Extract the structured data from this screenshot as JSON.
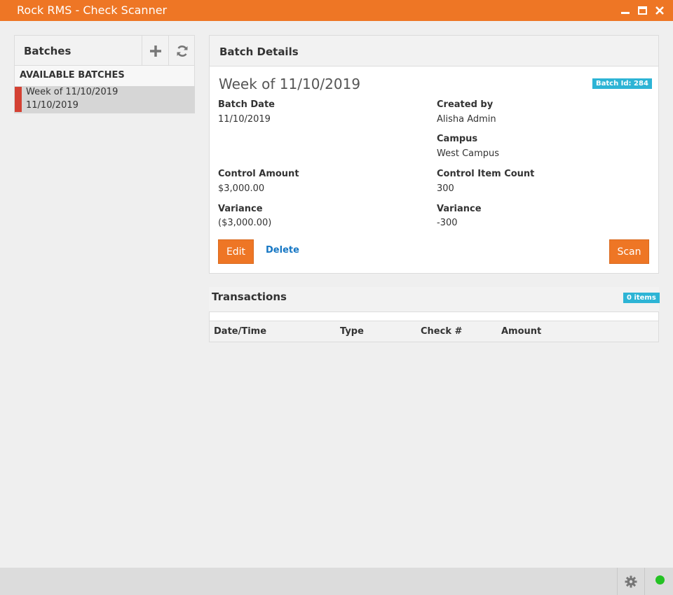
{
  "window": {
    "title": "Rock RMS - Check Scanner",
    "accent_color": "#ee7625"
  },
  "batches": {
    "header": "Batches",
    "add_icon": "plus-icon",
    "refresh_icon": "refresh-icon",
    "section_label": "AVAILABLE BATCHES",
    "items": [
      {
        "name": "Week of 11/10/2019",
        "date": "11/10/2019",
        "status_color": "#d44133"
      }
    ]
  },
  "details": {
    "header": "Batch Details",
    "title": "Week of 11/10/2019",
    "batch_id_badge": "Batch Id: 284",
    "batch_date_label": "Batch Date",
    "batch_date": "11/10/2019",
    "created_by_label": "Created by",
    "created_by": "Alisha Admin",
    "campus_label": "Campus",
    "campus": "West Campus",
    "control_amount_label": "Control Amount",
    "control_amount": "$3,000.00",
    "control_item_count_label": "Control Item Count",
    "control_item_count": "300",
    "variance_amount_label": "Variance",
    "variance_amount": "($3,000.00)",
    "variance_count_label": "Variance",
    "variance_count": "-300",
    "edit_label": "Edit",
    "delete_label": "Delete",
    "scan_label": "Scan"
  },
  "transactions": {
    "header": "Transactions",
    "items_badge": "0 items",
    "columns": [
      "Date/Time",
      "Type",
      "Check #",
      "Amount"
    ],
    "rows": []
  },
  "statusbar": {
    "settings_icon": "gear-icon",
    "connection_color": "#24c224"
  }
}
